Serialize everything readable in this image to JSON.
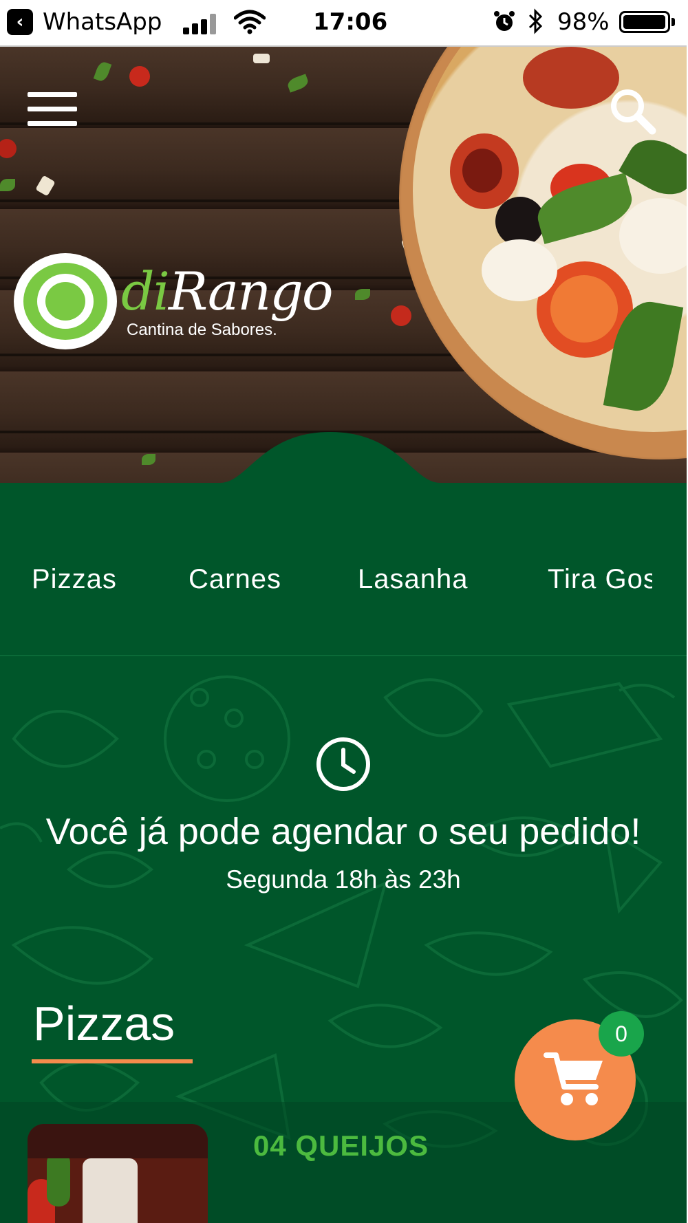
{
  "status_bar": {
    "back_app": "WhatsApp",
    "time": "17:06",
    "battery_percent": "98%",
    "battery_level": 0.98
  },
  "header": {
    "menu_icon": "hamburger-menu-icon",
    "search_icon": "search-icon"
  },
  "logo": {
    "brand_prefix": "di",
    "brand_name": "Rango",
    "tagline": "Cantina de Sabores."
  },
  "categories": [
    "Pizzas",
    "Carnes",
    "Lasanha",
    "Tira Gos"
  ],
  "schedule": {
    "icon": "clock-icon",
    "title": "Você já pode agendar o seu pedido!",
    "hours": "Segunda 18h às 23h"
  },
  "section": {
    "title": "Pizzas"
  },
  "products": [
    {
      "name": "04 QUEIJOS"
    }
  ],
  "cart": {
    "icon": "shopping-cart-icon",
    "count": "0"
  },
  "colors": {
    "primary_green": "#00562a",
    "accent_orange": "#f58b4c",
    "brand_light_green": "#7ac943",
    "product_title_green": "#4cba3f",
    "badge_green": "#19a54b"
  }
}
